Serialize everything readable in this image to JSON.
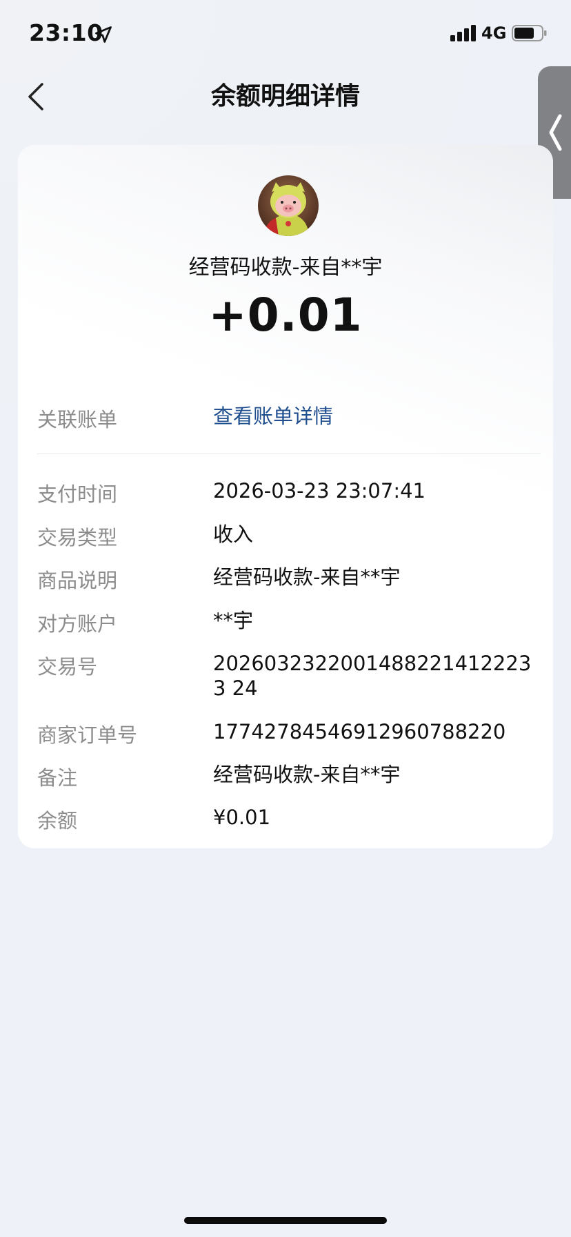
{
  "status_bar": {
    "time": "23:10",
    "network": "4G",
    "icons": [
      "location-arrow-icon",
      "signal-icon",
      "battery-icon"
    ]
  },
  "nav": {
    "title": "余额明细详情",
    "back_icon": "chevron-left-icon",
    "side_tab_icon": "chevron-left-icon"
  },
  "transaction": {
    "avatar_icon": "pig-avatar",
    "merchant": "经营码收款-来自**宇",
    "amount": "+0.01"
  },
  "linked_bill": {
    "label": "关联账单",
    "link_text": "查看账单详情"
  },
  "details": [
    {
      "label": "支付时间",
      "value": "2026-03-23 23:07:41"
    },
    {
      "label": "交易类型",
      "value": "收入"
    },
    {
      "label": "商品说明",
      "value": "经营码收款-来自**宇"
    },
    {
      "label": "对方账户",
      "value": "**宇"
    },
    {
      "label": "交易号",
      "value": "20260323220014882214122233 24"
    },
    {
      "label": "商家订单号",
      "value": "17742784546912960788220"
    },
    {
      "label": "备注",
      "value": "经营码收款-来自**宇"
    },
    {
      "label": "余额",
      "value": "¥0.01"
    }
  ],
  "colors": {
    "background": "#eef1f7",
    "card": "#ffffff",
    "link": "#1f4e8f",
    "label": "#8c8c8c",
    "side_tab": "#808285"
  }
}
